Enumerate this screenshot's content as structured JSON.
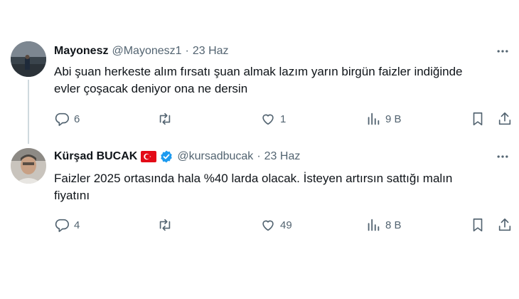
{
  "tweets": [
    {
      "display_name": "Mayonesz",
      "handle": "@Mayonesz1",
      "separator": "·",
      "date": "23 Haz",
      "text_line1": "Abi şuan herkeste alım fırsatı şuan almak lazım yarın birgün faizler indiğinde",
      "text_line2": "evler çoşacak deniyor ona ne dersin",
      "replies": "6",
      "retweets": "",
      "likes": "1",
      "views": "9 B",
      "verified": false,
      "flag": ""
    },
    {
      "display_name": "Kürşad BUCAK",
      "handle": "@kursadbucak",
      "separator": "·",
      "date": "23 Haz",
      "text_line1": "Faizler 2025 ortasında hala %40 larda olacak. İsteyen artırsın sattığı malın",
      "text_line2": "fiyatını",
      "replies": "4",
      "retweets": "",
      "likes": "49",
      "views": "8 B",
      "verified": true,
      "flag": "turkey-flag"
    }
  ],
  "colors": {
    "text": "#0f1419",
    "secondary": "#536471",
    "verified_blue": "#1d9bf0",
    "flag_red": "#e30a17",
    "thread_line": "#cfd9de"
  },
  "icons": [
    "reply-icon",
    "retweet-icon",
    "like-icon",
    "views-icon",
    "bookmark-icon",
    "share-icon",
    "more-icon",
    "verified-badge-icon",
    "turkey-flag-icon"
  ]
}
